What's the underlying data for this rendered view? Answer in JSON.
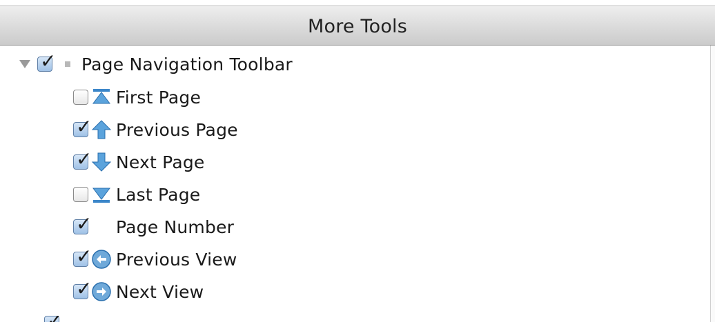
{
  "panel": {
    "title": "More Tools"
  },
  "tree": {
    "group": {
      "label": "Page Navigation Toolbar",
      "checked": true,
      "expanded": true
    },
    "items": [
      {
        "label": "First Page",
        "checked": false,
        "icon": "first-page-icon"
      },
      {
        "label": "Previous Page",
        "checked": true,
        "icon": "previous-page-icon"
      },
      {
        "label": "Next Page",
        "checked": true,
        "icon": "next-page-icon"
      },
      {
        "label": "Last Page",
        "checked": false,
        "icon": "last-page-icon"
      },
      {
        "label": "Page Number",
        "checked": true,
        "icon": ""
      },
      {
        "label": "Previous View",
        "checked": true,
        "icon": "previous-view-icon"
      },
      {
        "label": "Next View",
        "checked": true,
        "icon": "next-view-icon"
      }
    ]
  },
  "colors": {
    "header_top": "#eeeeee",
    "header_bottom": "#cbcbcb",
    "icon_blue": "#3b86c9"
  }
}
